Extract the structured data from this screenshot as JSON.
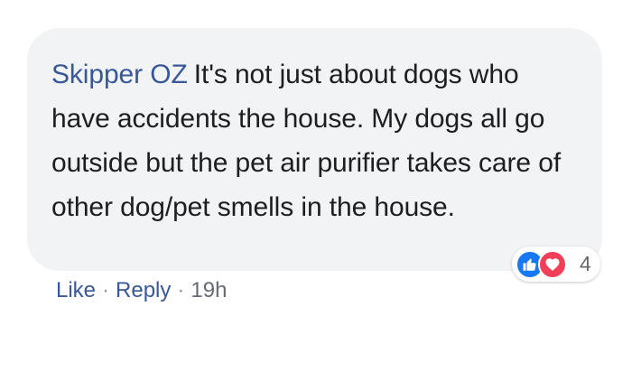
{
  "comment": {
    "author": "Skipper OZ",
    "text": "It's not just about dogs who have accidents the house. My dogs all go outside but the pet air purifier takes care of other dog/pet smells in the house.",
    "reactions": {
      "count": "4",
      "icons": [
        "like-icon",
        "heart-icon"
      ],
      "colors": {
        "like": "#1877f2",
        "love": "#f33e58"
      }
    },
    "actions": {
      "like_label": "Like",
      "reply_label": "Reply",
      "separator": "·",
      "time": "19h"
    }
  },
  "colors": {
    "bubble_background": "#f2f3f5",
    "author_name": "#385898",
    "body_text": "#1c1e21",
    "action_link": "#385898",
    "muted_text": "#90949c"
  }
}
